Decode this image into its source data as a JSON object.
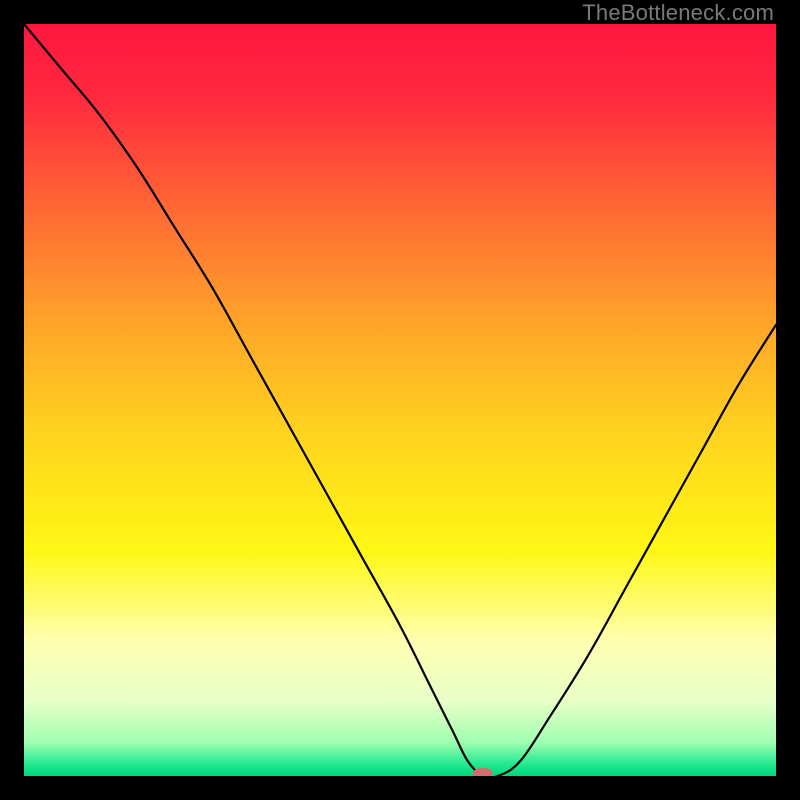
{
  "watermark": {
    "text": "TheBottleneck.com"
  },
  "chart_data": {
    "type": "line",
    "title": "",
    "xlabel": "",
    "ylabel": "",
    "xlim": [
      0,
      100
    ],
    "ylim": [
      0,
      100
    ],
    "grid": false,
    "background_gradient": {
      "stops": [
        {
          "offset": 0.0,
          "color": "#ff163f"
        },
        {
          "offset": 0.1,
          "color": "#ff2a3e"
        },
        {
          "offset": 0.25,
          "color": "#ff6a34"
        },
        {
          "offset": 0.4,
          "color": "#ffa529"
        },
        {
          "offset": 0.55,
          "color": "#ffd51e"
        },
        {
          "offset": 0.7,
          "color": "#fff714"
        },
        {
          "offset": 0.82,
          "color": "#ffffb0"
        },
        {
          "offset": 0.9,
          "color": "#e8ffc8"
        },
        {
          "offset": 0.955,
          "color": "#a0ffb0"
        },
        {
          "offset": 0.985,
          "color": "#20e890"
        },
        {
          "offset": 1.0,
          "color": "#00d87a"
        }
      ]
    },
    "series": [
      {
        "name": "bottleneck-curve",
        "color": "#000000",
        "x": [
          0,
          5,
          10,
          15,
          20,
          25,
          30,
          35,
          40,
          45,
          50,
          54,
          57,
          59,
          61,
          63,
          66,
          70,
          75,
          80,
          85,
          90,
          95,
          100
        ],
        "y": [
          100,
          94,
          88,
          81,
          73,
          65,
          56,
          47,
          38,
          29,
          20,
          12,
          6,
          2,
          0,
          0,
          2,
          8,
          16,
          25,
          34,
          43,
          52,
          60
        ]
      }
    ],
    "marker": {
      "name": "optimal-point",
      "x": 61,
      "y": 0,
      "color": "#d66b6b",
      "rx": 10,
      "ry": 5
    }
  }
}
